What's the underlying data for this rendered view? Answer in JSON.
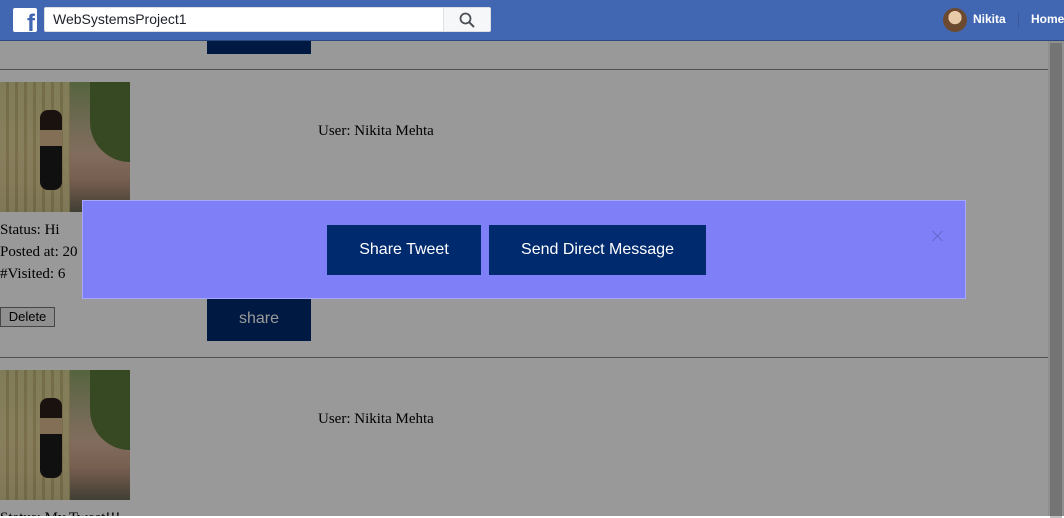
{
  "topbar": {
    "logo_letter": "f",
    "search_value": "WebSystemsProject1",
    "user_name": "Nikita",
    "home_label": "Home"
  },
  "posts": [
    {
      "user": "User: Nikita Mehta",
      "status": "Status: Hi",
      "posted_at": "Posted at: 20",
      "visited": "#Visited: 6",
      "delete_label": "Delete",
      "share_label": "share"
    },
    {
      "user": "User: Nikita Mehta",
      "status": "Status: My Tweet!!!"
    }
  ],
  "modal": {
    "share_tweet_label": "Share Tweet",
    "send_dm_label": "Send Direct Message"
  },
  "icons": {
    "search": "search-icon",
    "close": "close-icon"
  },
  "colors": {
    "topbar": "#4267b2",
    "button_navy": "#002a6e",
    "modal_bg": "#7f7ff8"
  }
}
